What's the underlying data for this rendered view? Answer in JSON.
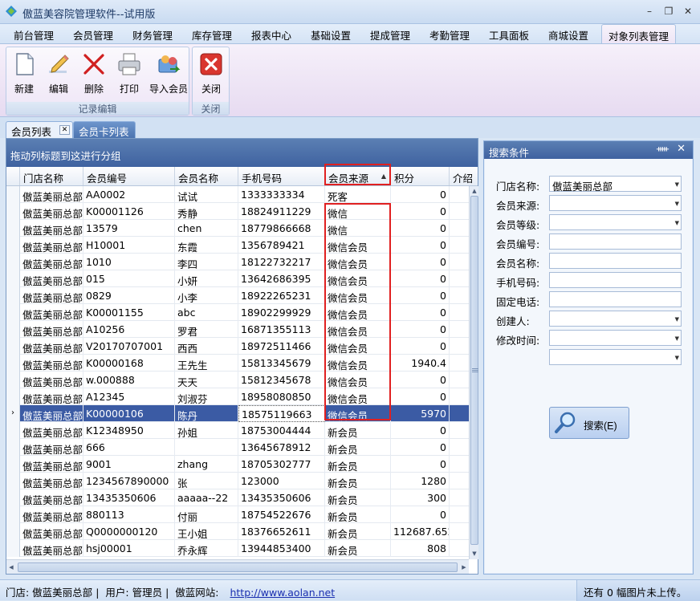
{
  "app": {
    "title": "傲蓝美容院管理软件--试用版",
    "min": "–",
    "restore": "❐",
    "close": "✕"
  },
  "menu": [
    "前台管理",
    "会员管理",
    "财务管理",
    "库存管理",
    "报表中心",
    "基础设置",
    "提成管理",
    "考勤管理",
    "工具面板",
    "商城设置",
    "对象列表管理"
  ],
  "ribbon": {
    "record_group": "记录编辑",
    "close_group": "关闭",
    "buttons": {
      "new": "新建",
      "edit": "编辑",
      "delete": "删除",
      "print": "打印",
      "import": "导入会员",
      "close": "关闭"
    }
  },
  "doctabs": {
    "member_list": "会员列表",
    "card_list": "会员卡列表"
  },
  "grid": {
    "groupby_hint": "拖动列标题到这进行分组",
    "columns": [
      "门店名称",
      "会员编号",
      "会员名称",
      "手机号码",
      "会员来源",
      "积分",
      "介绍"
    ],
    "rows": [
      [
        "傲蓝美丽总部",
        "AA0002",
        "试试",
        "1333333334",
        "死客",
        "0"
      ],
      [
        "傲蓝美丽总部",
        "K00001126",
        "秀静",
        "18824911229",
        "微信",
        "0"
      ],
      [
        "傲蓝美丽总部",
        "13579",
        "chen",
        "18779866668",
        "微信",
        "0"
      ],
      [
        "傲蓝美丽总部",
        "H10001",
        "东霞",
        "1356789421",
        "微信会员",
        "0"
      ],
      [
        "傲蓝美丽总部",
        "1010",
        "李四",
        "18122732217",
        "微信会员",
        "0"
      ],
      [
        "傲蓝美丽总部",
        "015",
        "小妍",
        "13642686395",
        "微信会员",
        "0"
      ],
      [
        "傲蓝美丽总部",
        "0829",
        "小李",
        "18922265231",
        "微信会员",
        "0"
      ],
      [
        "傲蓝美丽总部",
        "K00001155",
        "abc",
        "18902299929",
        "微信会员",
        "0"
      ],
      [
        "傲蓝美丽总部",
        "A10256",
        "罗君",
        "16871355113",
        "微信会员",
        "0"
      ],
      [
        "傲蓝美丽总部",
        "V20170707001",
        "西西",
        "18972511466",
        "微信会员",
        "0"
      ],
      [
        "傲蓝美丽总部",
        "K00000168",
        "王先生",
        "15813345679",
        "微信会员",
        "1940.4"
      ],
      [
        "傲蓝美丽总部",
        "w.000888",
        "天天",
        "15812345678",
        "微信会员",
        "0"
      ],
      [
        "傲蓝美丽总部",
        "A12345",
        "刘淑芬",
        "18958080850",
        "微信会员",
        "0"
      ],
      [
        "傲蓝美丽总部",
        "K00000106",
        "陈丹",
        "18575119663",
        "微信会员",
        "5970"
      ],
      [
        "傲蓝美丽总部",
        "K12348950",
        "孙姐",
        "18753004444",
        "新会员",
        "0"
      ],
      [
        "傲蓝美丽总部",
        "666",
        "",
        "13645678912",
        "新会员",
        "0"
      ],
      [
        "傲蓝美丽总部",
        "9001",
        "zhang",
        "18705302777",
        "新会员",
        "0"
      ],
      [
        "傲蓝美丽总部",
        "1234567890000",
        "张",
        "123000",
        "新会员",
        "1280"
      ],
      [
        "傲蓝美丽总部",
        "13435350606",
        "aaaaa--22",
        "13435350606",
        "新会员",
        "300"
      ],
      [
        "傲蓝美丽总部",
        "880113",
        "付丽",
        "18754522676",
        "新会员",
        "0"
      ],
      [
        "傲蓝美丽总部",
        "Q0000000120",
        "王小姐",
        "18376652611",
        "新会员",
        "112687.652"
      ],
      [
        "傲蓝美丽总部",
        "hsj00001",
        "乔永辉",
        "13944853400",
        "新会员",
        "808"
      ]
    ],
    "selected_index": 13
  },
  "search": {
    "title": "搜索条件",
    "pin": "ᚔ",
    "close": "✕",
    "fields": [
      {
        "label": "门店名称:",
        "value": "傲蓝美丽总部",
        "combo": true
      },
      {
        "label": "会员来源:",
        "value": "",
        "combo": true
      },
      {
        "label": "会员等级:",
        "value": "",
        "combo": true
      },
      {
        "label": "会员编号:",
        "value": "",
        "combo": false
      },
      {
        "label": "会员名称:",
        "value": "",
        "combo": false
      },
      {
        "label": "手机号码:",
        "value": "",
        "combo": false
      },
      {
        "label": "固定电话:",
        "value": "",
        "combo": false
      },
      {
        "label": "创建人:",
        "value": "",
        "combo": true
      },
      {
        "label": "修改时间:",
        "value": "",
        "combo": true
      },
      {
        "label": "",
        "value": "",
        "combo": true
      }
    ],
    "button": "搜索(E)"
  },
  "status": {
    "store": "门店: 傲蓝美丽总部",
    "user": "用户: 管理员",
    "site_label": "傲蓝网站:",
    "site_url": "http://www.aolan.net",
    "upload": "还有 0 幅图片未上传。"
  }
}
